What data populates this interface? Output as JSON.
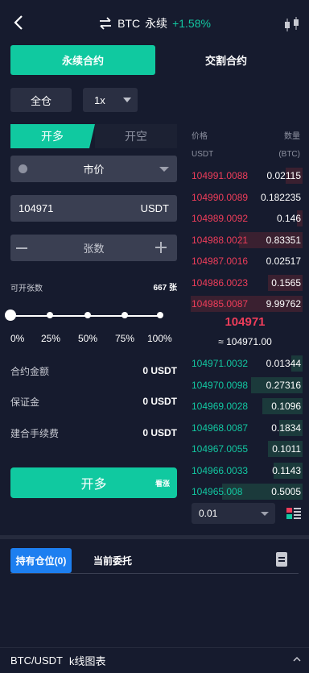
{
  "header": {
    "symbol": "BTC",
    "contract_type": "永续",
    "change": "+1.58%",
    "icons": [
      "back-icon",
      "swap-icon",
      "settings-icon"
    ]
  },
  "top_tabs": {
    "perpetual": "永续合约",
    "delivery": "交割合约"
  },
  "margin_mode": "全仓",
  "leverage": "1x",
  "side_tabs": {
    "long": "开多",
    "short": "开空"
  },
  "order_type": "市价",
  "price_input": {
    "value": "104971",
    "unit": "USDT"
  },
  "quantity_input": {
    "placeholder": "张数"
  },
  "available": {
    "label": "可开张数",
    "value": "667 张"
  },
  "slider": {
    "level": 0,
    "marks": [
      "0%",
      "25%",
      "50%",
      "75%",
      "100%"
    ]
  },
  "info": [
    {
      "label": "合约金额",
      "value": "0 USDT"
    },
    {
      "label": "保证金",
      "value": "0 USDT"
    },
    {
      "label": "建合手续费",
      "value": "0 USDT"
    }
  ],
  "open_button": {
    "label": "开多",
    "sub": "看涨"
  },
  "orderbook": {
    "header": {
      "price": "价格",
      "qty": "数量",
      "price_unit": "USDT",
      "qty_unit": "(BTC)"
    },
    "asks": [
      {
        "price": "104991.0088",
        "qty": "0.02115",
        "depth": 0.15
      },
      {
        "price": "104990.0089",
        "qty": "0.182235",
        "depth": 0.0
      },
      {
        "price": "104989.0092",
        "qty": "0.146",
        "depth": 0.05
      },
      {
        "price": "104988.0021",
        "qty": "0.83351",
        "depth": 0.55
      },
      {
        "price": "104987.0016",
        "qty": "0.02517",
        "depth": 0.0
      },
      {
        "price": "104986.0023",
        "qty": "0.1565",
        "depth": 0.3
      },
      {
        "price": "104985.0087",
        "qty": "9.99762",
        "depth": 0.97
      }
    ],
    "last_price": "104971",
    "last_price_sub": "≈ 104971.00",
    "bids": [
      {
        "price": "104971.0032",
        "qty": "0.01344",
        "depth": 0.1
      },
      {
        "price": "104970.0098",
        "qty": "0.27316",
        "depth": 0.45
      },
      {
        "price": "104969.0028",
        "qty": "0.1096",
        "depth": 0.35
      },
      {
        "price": "104968.0087",
        "qty": "0.1834",
        "depth": 0.2
      },
      {
        "price": "104967.0055",
        "qty": "0.1011",
        "depth": 0.3
      },
      {
        "price": "104966.0033",
        "qty": "0.1143",
        "depth": 0.25
      },
      {
        "price": "104965.008",
        "qty": "0.5005",
        "depth": 0.7
      }
    ],
    "precision": "0.01"
  },
  "positions_tabs": {
    "holdings": "持有仓位(0)",
    "orders": "当前委托"
  },
  "bottom_bar": {
    "pair": "BTC/USDT",
    "label": "k线图表"
  },
  "colors": {
    "accent": "#10c9a0",
    "ask": "#ee3d5a",
    "bid": "#12c7a1",
    "tab_blue": "#1d7ff0",
    "bg": "#161b2e"
  }
}
